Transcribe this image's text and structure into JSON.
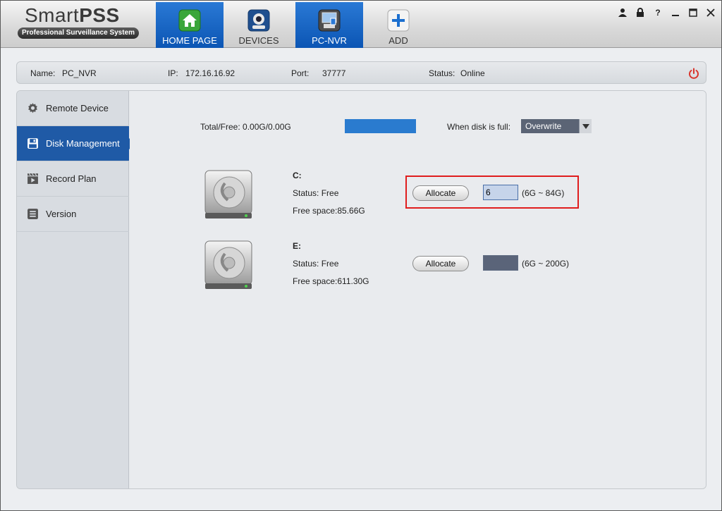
{
  "app": {
    "logo_title_light": "Smart",
    "logo_title_bold": "PSS",
    "logo_subtitle": "Professional Surveillance System"
  },
  "tabs": [
    {
      "label": "HOME PAGE",
      "icon": "home-icon",
      "active": true
    },
    {
      "label": "DEVICES",
      "icon": "camera-icon",
      "active": false
    },
    {
      "label": "PC-NVR",
      "icon": "nvr-icon",
      "active": true
    },
    {
      "label": "ADD",
      "icon": "plus-icon",
      "active": false
    }
  ],
  "window_controls": [
    "user-icon",
    "lock-icon",
    "help-icon",
    "minimize-icon",
    "maximize-icon",
    "close-icon"
  ],
  "info": {
    "name_label": "Name:",
    "name_value": "PC_NVR",
    "ip_label": "IP:",
    "ip_value": "172.16.16.92",
    "port_label": "Port:",
    "port_value": "37777",
    "status_label": "Status:",
    "status_value": "Online"
  },
  "sidebar": {
    "items": [
      {
        "label": "Remote Device",
        "icon": "gear-icon",
        "active": false
      },
      {
        "label": "Disk Management",
        "icon": "floppy-icon",
        "active": true
      },
      {
        "label": "Record Plan",
        "icon": "clapperboard-icon",
        "active": false
      },
      {
        "label": "Version",
        "icon": "list-icon",
        "active": false
      }
    ]
  },
  "disk_summary": {
    "total_free": "Total/Free: 0.00G/0.00G",
    "when_full_label": "When disk is full:",
    "when_full_value": "Overwrite"
  },
  "disks": [
    {
      "name": "C:",
      "status": "Status: Free",
      "free": "Free space:85.66G",
      "button": "Allocate",
      "value": "6",
      "range": "(6G ~ 84G)"
    },
    {
      "name": "E:",
      "status": "Status: Free",
      "free": "Free space:611.30G",
      "button": "Allocate",
      "value": "",
      "range": "(6G ~ 200G)"
    }
  ],
  "colors": {
    "accent": "#0b55b4",
    "highlight": "#e01d1d",
    "power": "#d9342b"
  }
}
